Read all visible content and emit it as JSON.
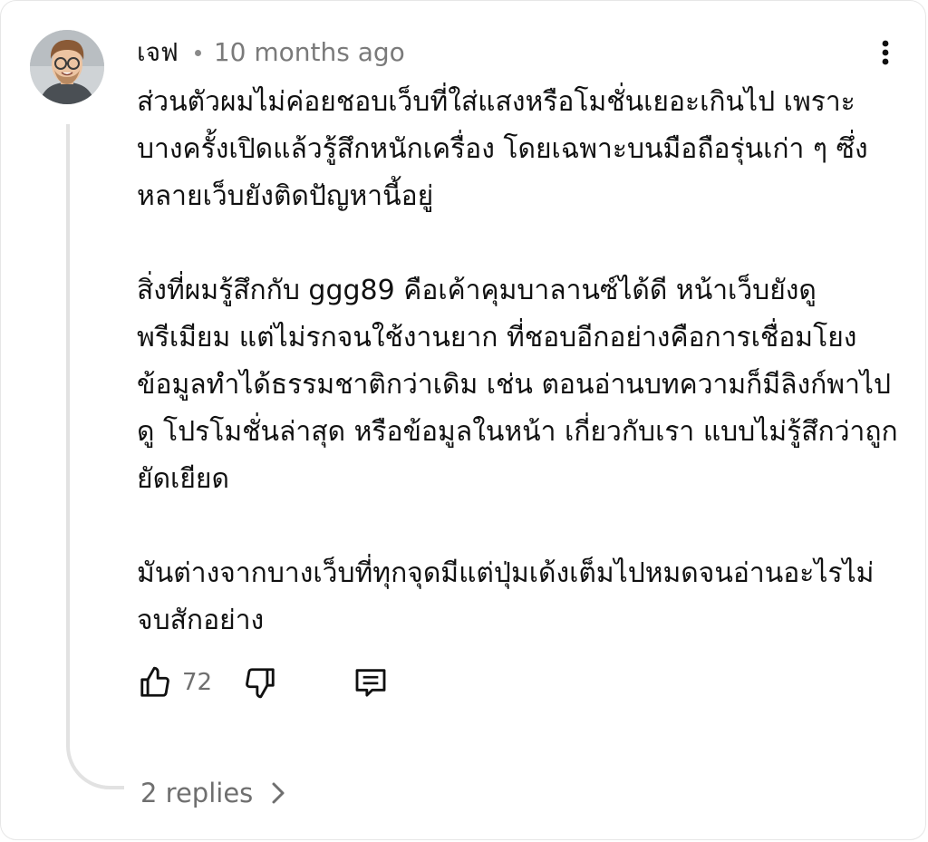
{
  "comment": {
    "author": "เจฟ",
    "timestamp": "10 months ago",
    "paragraphs": [
      "ส่วนตัวผมไม่ค่อยชอบเว็บที่ใส่แสงหรือโมชั่นเยอะเกินไป เพราะบางครั้งเปิดแล้วรู้สึกหนักเครื่อง โดยเฉพาะบนมือถือรุ่นเก่า ๆ ซึ่งหลายเว็บยังติดปัญหานี้อยู่",
      "สิ่งที่ผมรู้สึกกับ ggg89 คือเค้าคุมบาลานซ์ได้ดี หน้าเว็บยังดูพรีเมียม แต่ไม่รกจนใช้งานยาก ที่ชอบอีกอย่างคือการเชื่อมโยงข้อมูลทำได้ธรรมชาติกว่าเดิม เช่น ตอนอ่านบทความก็มีลิงก์พาไปดู โปรโมชั่นล่าสุด หรือข้อมูลในหน้า เกี่ยวกับเรา แบบไม่รู้สึกว่าถูกยัดเยียด",
      "มันต่างจากบางเว็บที่ทุกจุดมีแต่ปุ่มเด้งเต็มไปหมดจนอ่านอะไรไม่จบสักอย่าง"
    ],
    "like_count": "72",
    "replies_label": "2 replies"
  },
  "icons": {
    "more": "more-vertical-icon",
    "like": "thumbs-up-icon",
    "dislike": "thumbs-down-icon",
    "reply": "comment-reply-icon",
    "expand": "chevron-right-icon"
  },
  "colors": {
    "text": "#111111",
    "muted": "#6f6f6f",
    "thread_line": "#e2e2e2"
  }
}
